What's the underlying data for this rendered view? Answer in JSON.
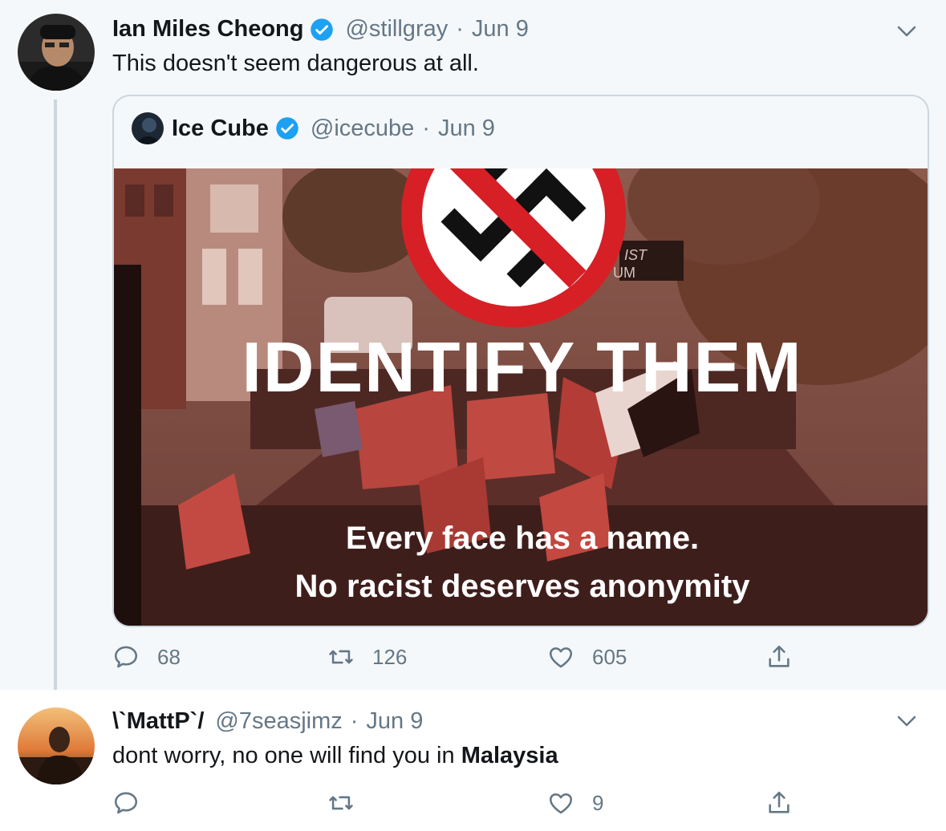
{
  "tweets": [
    {
      "author": {
        "name": "Ian Miles Cheong",
        "handle": "@stillgray",
        "verified": true
      },
      "date": "Jun 9",
      "text": "This doesn't seem dangerous at all.",
      "quoted": {
        "author": {
          "name": "Ice Cube",
          "handle": "@icecube",
          "verified": true
        },
        "date": "Jun 9",
        "image": {
          "headline": "IDENTIFY THEM",
          "line1": "Every face has a name.",
          "line2": "No racist deserves anonymity",
          "sign_text": "IST\nUM"
        }
      },
      "stats": {
        "replies": "68",
        "retweets": "126",
        "likes": "605"
      }
    },
    {
      "author": {
        "name": "\\`MattP`/",
        "handle": "@7seasjimz",
        "verified": false
      },
      "date": "Jun 9",
      "text_plain": "dont worry, no one will find you in ",
      "text_bold": "Malaysia",
      "stats": {
        "replies": "",
        "retweets": "",
        "likes": "9"
      }
    }
  ],
  "icons": {
    "reply": "reply-icon",
    "retweet": "retweet-icon",
    "like": "heart-icon",
    "share": "share-icon",
    "menu": "chevron-down-icon",
    "verified": "verified-badge-icon"
  },
  "colors": {
    "text_primary": "#14171a",
    "text_secondary": "#657786",
    "verified_blue": "#1da1f2",
    "thread_line": "#ccd6dd",
    "tweet_bg": "#f5f8fa"
  }
}
